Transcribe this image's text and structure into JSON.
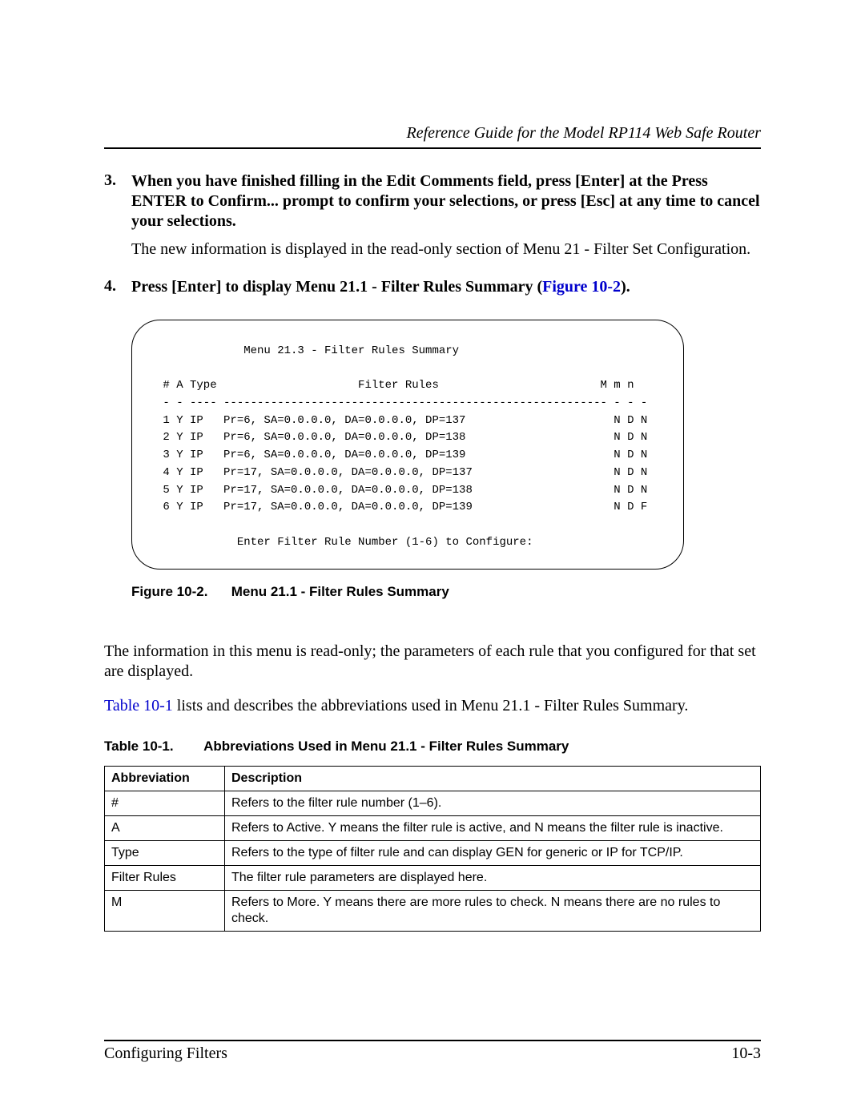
{
  "header": {
    "running_head": "Reference Guide for the Model RP114 Web Safe Router"
  },
  "steps": {
    "s3": {
      "num": "3.",
      "bold": "When you have finished filling in the Edit Comments field, press [Enter] at the Press ENTER to Confirm... prompt to confirm your selections, or press [Esc] at any time to cancel your selections.",
      "follow": "The new information is displayed in the read-only section of Menu 21 - Filter Set Configuration."
    },
    "s4": {
      "num": "4.",
      "bold_pre": "Press [Enter] to display Menu 21.1 - Filter Rules Summary (",
      "xref": "Figure 10-2",
      "bold_post": ")."
    }
  },
  "figure": {
    "title": "             Menu 21.3 - Filter Rules Summary",
    "header": " # A Type                     Filter Rules                        M m n",
    "divider": " - - ---- --------------------------------------------------------- - - -",
    "rows": [
      " 1 Y IP   Pr=6, SA=0.0.0.0, DA=0.0.0.0, DP=137                      N D N",
      " 2 Y IP   Pr=6, SA=0.0.0.0, DA=0.0.0.0, DP=138                      N D N",
      " 3 Y IP   Pr=6, SA=0.0.0.0, DA=0.0.0.0, DP=139                      N D N",
      " 4 Y IP   Pr=17, SA=0.0.0.0, DA=0.0.0.0, DP=137                     N D N",
      " 5 Y IP   Pr=17, SA=0.0.0.0, DA=0.0.0.0, DP=138                     N D N",
      " 6 Y IP   Pr=17, SA=0.0.0.0, DA=0.0.0.0, DP=139                     N D F"
    ],
    "prompt": "            Enter Filter Rule Number (1-6) to Configure:",
    "caption_label": "Figure 10-2.",
    "caption_text": "Menu 21.1 - Filter Rules Summary"
  },
  "para1": "The information in this menu is read-only; the parameters of each rule that you configured for that set are displayed.",
  "para2_pre": "",
  "para2_xref": "Table 10-1",
  "para2_post": " lists and describes the abbreviations used in Menu 21.1 - Filter Rules Summary.",
  "table": {
    "caption_label": "Table 10-1.",
    "caption_text": "Abbreviations Used in Menu 21.1 - Filter Rules Summary",
    "head": {
      "c1": "Abbreviation",
      "c2": "Description"
    },
    "rows": [
      {
        "c1": "#",
        "c2": "Refers to the filter rule number (1–6)."
      },
      {
        "c1": "A",
        "c2": "Refers to Active. Y means the filter rule is active, and N means the filter rule is inactive."
      },
      {
        "c1": "Type",
        "c2": "Refers to the type of filter rule and can display GEN for generic or IP for TCP/IP."
      },
      {
        "c1": "Filter Rules",
        "c2": "The filter rule parameters are displayed here."
      },
      {
        "c1": "M",
        "c2": "Refers to More. Y means there are more rules to check. N means there are no rules to check."
      }
    ]
  },
  "footer": {
    "left": "Configuring Filters",
    "right": "10-3"
  }
}
